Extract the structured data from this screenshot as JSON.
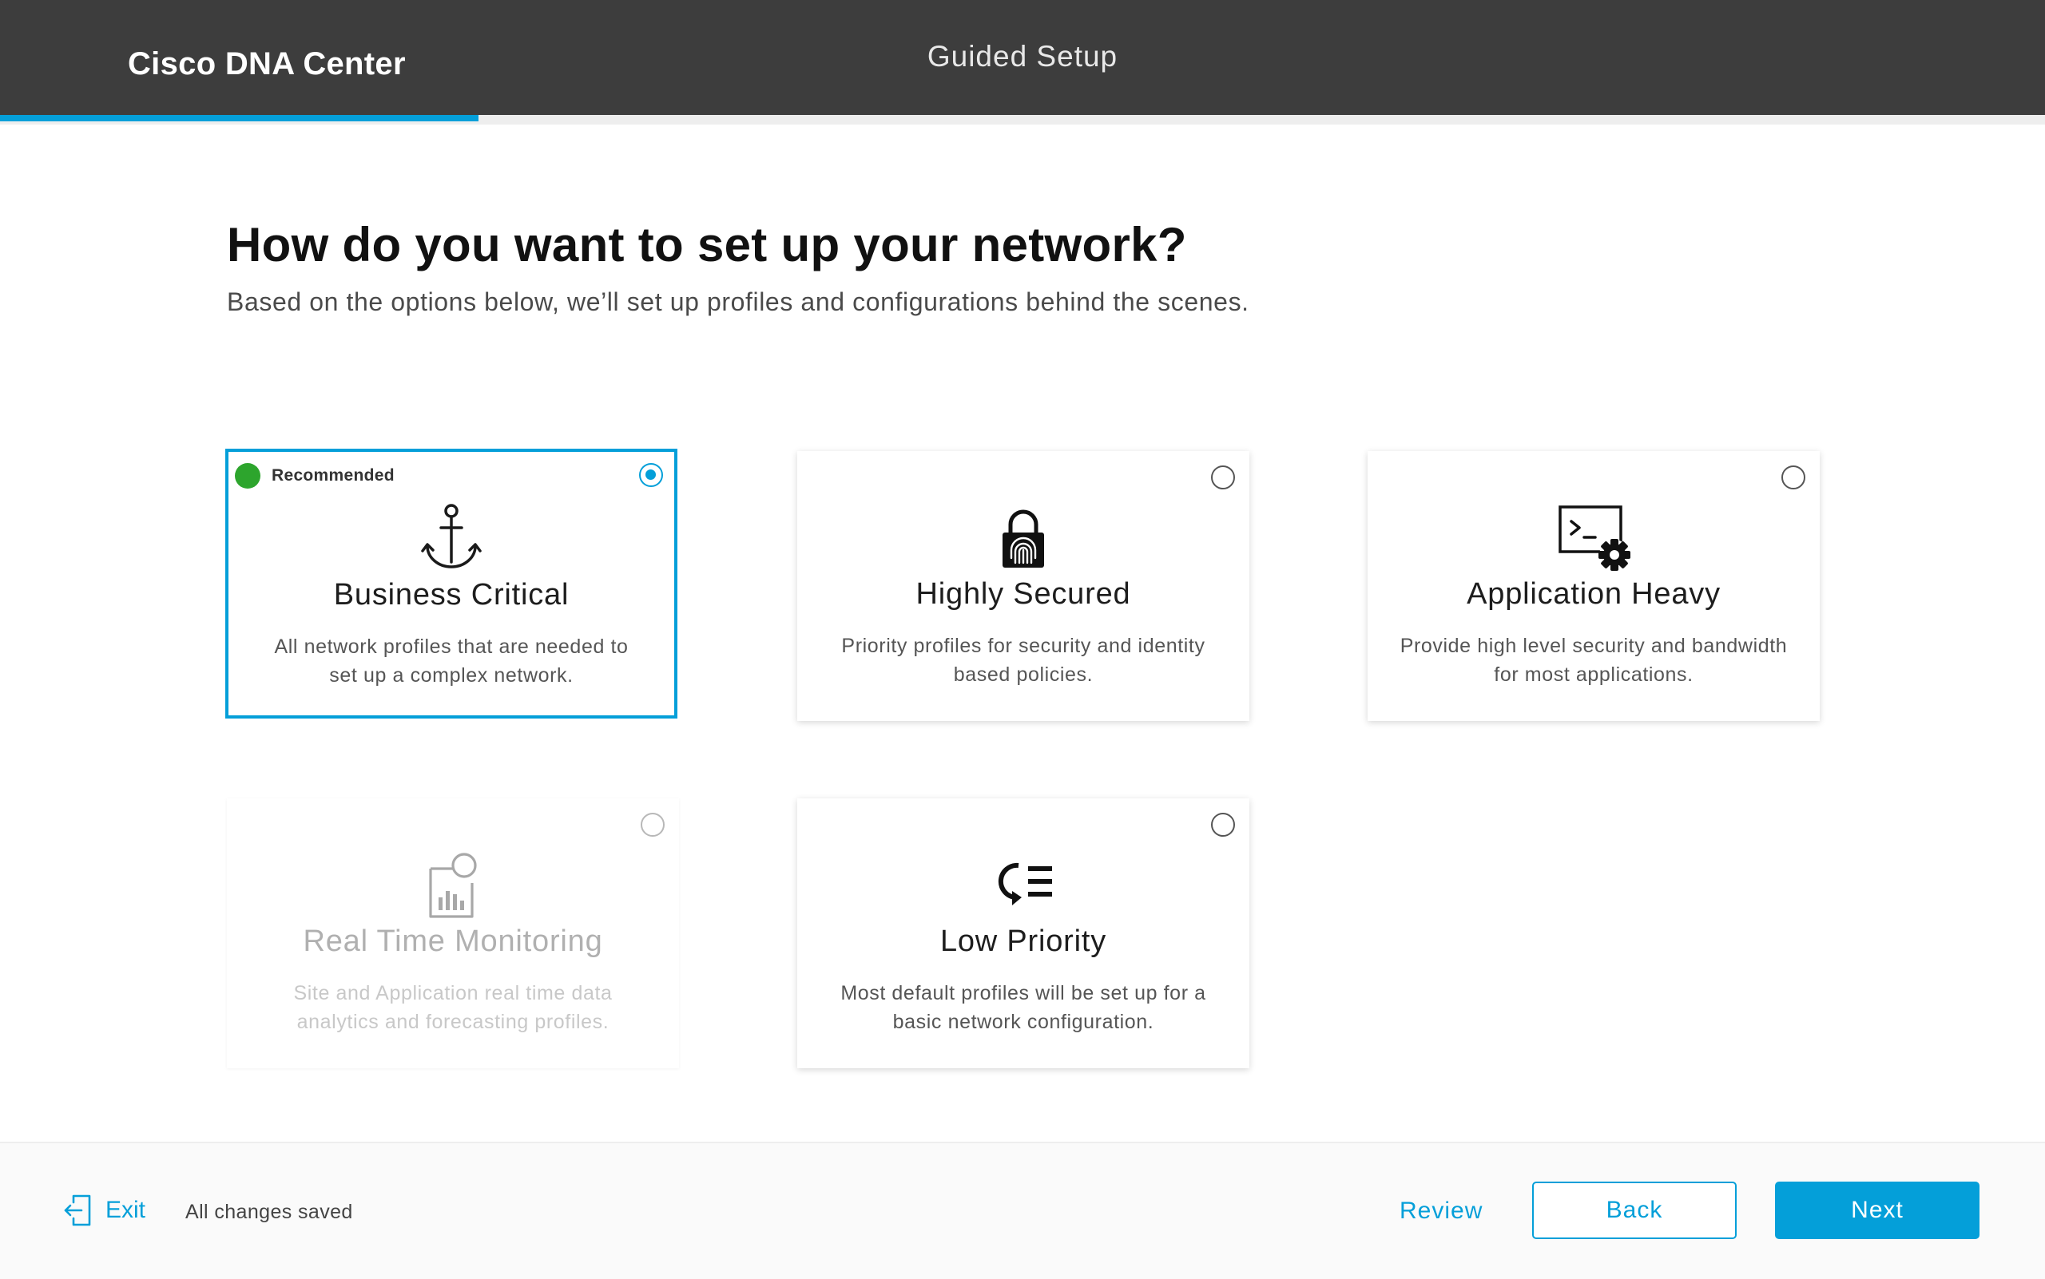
{
  "header": {
    "brand": "Cisco DNA Center",
    "title": "Guided Setup",
    "progress_percent": 23.4
  },
  "page": {
    "heading": "How do you want to set up your network?",
    "subheading": "Based on the options below, we’ll set up profiles and configurations behind the scenes."
  },
  "options": [
    {
      "title": "Business Critical",
      "description": "All network profiles that are needed to set up a complex network.",
      "badge": "Recommended",
      "icon": "anchor-icon",
      "selected": true,
      "disabled": false
    },
    {
      "title": "Highly Secured",
      "description": "Priority profiles for security and identity based policies.",
      "icon": "fingerprint-lock-icon",
      "selected": false,
      "disabled": false
    },
    {
      "title": "Application Heavy",
      "description": "Provide high level security and bandwidth for most applications.",
      "icon": "terminal-gear-icon",
      "selected": false,
      "disabled": false
    },
    {
      "title": "Real Time Monitoring",
      "description": "Site and Application real time data analytics and forecasting profiles.",
      "icon": "analytics-report-icon",
      "selected": false,
      "disabled": true
    },
    {
      "title": "Low Priority",
      "description": "Most default profiles will be set up for a basic network configuration.",
      "icon": "low-priority-list-icon",
      "selected": false,
      "disabled": false
    }
  ],
  "footer": {
    "exit_label": "Exit",
    "status": "All changes saved",
    "review_label": "Review",
    "back_label": "Back",
    "next_label": "Next"
  },
  "colors": {
    "accent": "#049fd9",
    "header_bg": "#3d3d3d",
    "recommended": "#2da52d",
    "disabled_text": "#b0b0b0"
  }
}
